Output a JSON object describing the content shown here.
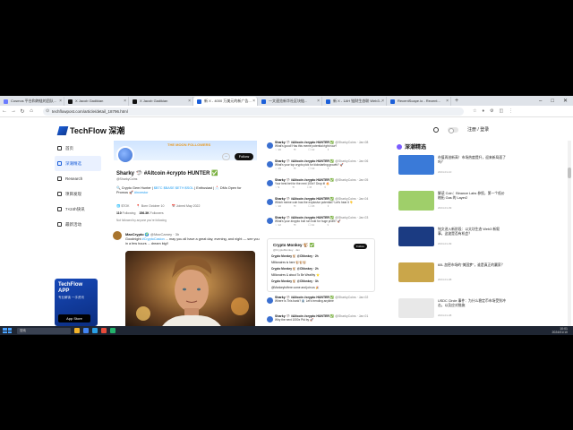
{
  "browser": {
    "tabs": [
      {
        "label": "Cosmos 平台和跨链的团队...",
        "color": "#6b7cff"
      },
      {
        "label": "X Jacob Gadikian",
        "color": "#111111"
      },
      {
        "label": "X Jacob Gadikian",
        "color": "#111111"
      },
      {
        "label": "新 X - 4000 万美元的新广告...",
        "color": "#1b5fd9",
        "active": true
      },
      {
        "label": "一文速览新华社区块链...",
        "color": "#1b5fd9"
      },
      {
        "label": "新 X - 1AH 链财生态联 Web3...",
        "color": "#1b5fd9"
      },
      {
        "label": "RecentScape.io - Recent...",
        "color": "#1b5fd9"
      }
    ],
    "new_tab": "+",
    "window_buttons": [
      "–",
      "□",
      "✕"
    ],
    "url": "techflowpost.com/article/detail_18796.html",
    "nav_icons": [
      "←",
      "→",
      "↻",
      "⌂"
    ],
    "ext_icons": [
      "☆",
      "♦",
      "⚙",
      "◫",
      "⋮"
    ]
  },
  "site": {
    "logo": "TechFlow 深潮",
    "header_icons": [
      "search-icon",
      "theme-toggle",
      "user-icon"
    ],
    "login": "注册 / 登录"
  },
  "sidenav": [
    {
      "label": "首页",
      "active": false
    },
    {
      "label": "深潮精选",
      "active": true
    },
    {
      "label": "Research",
      "active": false
    },
    {
      "label": "项目发现",
      "active": false
    },
    {
      "label": "7×24h快讯",
      "active": false
    },
    {
      "label": "最新活动",
      "active": false
    }
  ],
  "app_promo": {
    "title_line1": "TechFlow",
    "title_line2": "APP",
    "subtitle": "专业解读 一手资讯",
    "store": "App Store"
  },
  "profile": {
    "banner_text": "THE MOON FOLLOWERS",
    "name": "Sharky 🦈 #Altcoin #crypto HUNTER ✅",
    "handle": "@SharkyCoins",
    "bio_prefix": "🔍 Crypto Gem Hunter |",
    "bio_links": "$BTC $BASE $ETH $SOL",
    "bio_suffix": "| Enthusiast | 📩 DMs Open for Promos 🚀",
    "bio_link2": "#investor",
    "meta": [
      "🌐 $TOK",
      "📍 Born October 10",
      "📅 Joined May 2022"
    ],
    "following": "110",
    "following_label": "Following",
    "followers": "156.3K",
    "followers_label": "Followers",
    "note": "Not followed by anyone you're following",
    "follow_button": "Follow",
    "menu": "···"
  },
  "tweet": {
    "name": "MaxCrypto 🌍",
    "handle": "@MaxCamey · 3h",
    "body_prefix": "Goodnight",
    "body_link": "#CryptoCasion",
    "body_suffix": "... may you all have a great day, evening, and night — see you in a few hours ... dream big!!"
  },
  "embeds": [
    {
      "name": "Sharky 🦈 #Altcoin #crypto HUNTER ✅",
      "handle": "@SharkyCoins · Jan 08",
      "text": "What's good! Has this meme potential right now?",
      "actions": [
        "♡ 16",
        "⟲",
        "☐ 12",
        "⇪"
      ]
    },
    {
      "name": "Sharky 🦈 #Altcoin #crypto HUNTER ✅",
      "handle": "@SharkyCoins · Jan 06",
      "text": "What's your top crypto pick for kickstarting growth? 🚀",
      "actions": [
        "♡ 15",
        "⟲",
        "☐ 13",
        "⇪"
      ]
    },
    {
      "name": "Sharky 🦈 #Altcoin #crypto HUNTER ✅",
      "handle": "@SharkyCoins · Jan 05",
      "text": "Your best bet for the next 100x? Drop it! 🔥",
      "actions": [
        "♡ 9",
        "⟲",
        "☐ 8",
        "⇪"
      ]
    },
    {
      "name": "Sharky 🦈 #Altcoin #crypto HUNTER ✅",
      "handle": "@SharkyCoins · Jan 04",
      "text": "Which meme coin has the explosive potential? Let's hear it 👇",
      "actions": [
        "♡ 10",
        "⟲",
        "☐ 15",
        "⇪"
      ]
    },
    {
      "name": "Sharky 🦈 #Altcoin #crypto HUNTER ✅",
      "handle": "@SharkyCoins · Jan 03",
      "text": "What's your #crypto bull run hold for huge profit? 🚀",
      "actions": [
        "♡ 12",
        "⟲",
        "☐ 11",
        "⇪"
      ]
    }
  ],
  "community": {
    "title": "Crypto Monkey 🐒 ✅",
    "subtitle": "@CryptoMonkey · Jan",
    "follow": "Follow",
    "rows": [
      "Crypto Monkey 🐒 @CMonkey · 2h",
      "Millionaires is here 🐒🐒🐒",
      "Crypto Monkey 🐒 @CMonkey · 2h",
      "Millionaires & about To Be Wealthy ⭐",
      "Crypto Monkey 🐒 @CMonkey · 3h",
      "@MonkeyIsHere come and join us 🎉"
    ]
  },
  "embeds2": [
    {
      "name": "Sharky 🦈 #Altcoin #crypto HUNTER ✅",
      "handle": "@SharkyCoins · Jan 02",
      "text": "Where is This bank? 🏦 Let's trending anytime"
    },
    {
      "name": "Sharky 🦈 #Altcoin #crypto HUNTER ✅",
      "handle": "@SharkyCoins · Jan 01",
      "text": "Why the next 1000x Ptd by 🚀"
    }
  ],
  "rightcol": {
    "title": "深潮精选",
    "items": [
      {
        "text": "市值再创新高！市场热度提升，迎来新局面了吗？",
        "date": "2024-01-10",
        "color": "#3a7ad8"
      },
      {
        "text": "解读 Coin：Binance Labs 参投，第一个低价格拓 Gas 的 Layer2",
        "date": "2024-01-09",
        "color": "#9fcf6a"
      },
      {
        "text": "铭文进入新阶段：以太坊生态 Web3 新叙事，这波是否有机会？",
        "date": "2024-01-09",
        "color": "#1b3b82"
      },
      {
        "text": "60L 加密市场的\"美国梦\"，谁是真正的赢家？",
        "date": "2024-01-08",
        "color": "#caa64a"
      },
      {
        "text": "USDC Circle 事件：为什么稳定币市场受到冲击，以及应对措施",
        "date": "2024-01-08",
        "color": "#e8e8e8"
      }
    ]
  },
  "taskbar": {
    "search": "搜索",
    "time": "10:01",
    "date": "2024/01/10"
  }
}
